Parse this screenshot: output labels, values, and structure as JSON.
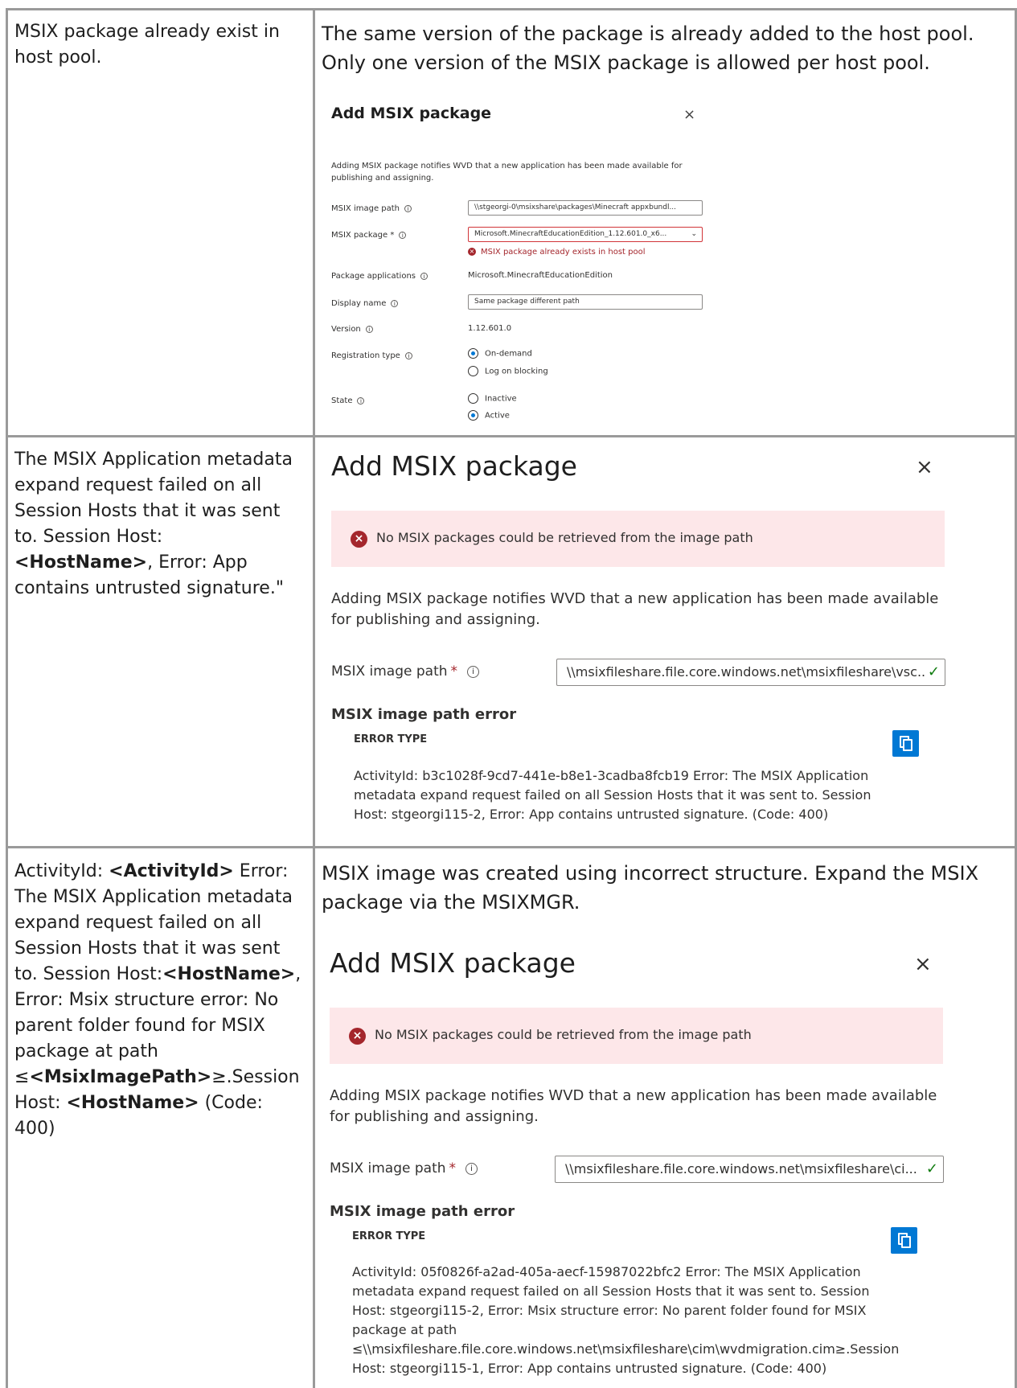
{
  "rows": [
    {
      "left_parts": [
        {
          "text": "MSIX package already exist in host pool.",
          "bold": false
        }
      ],
      "right_intro": "The same version of the package is already added to the host pool. Only one version of the MSIX package is allowed per host pool.",
      "dialog": {
        "title": "Add MSIX package",
        "close": "×",
        "description": "Adding MSIX package notifies WVD that a new application has been made available for publishing and assigning.",
        "image_path_label": "MSIX image path",
        "image_path_value": "\\\\stgeorgi-0\\msixshare\\packages\\Minecraft appxbundl...",
        "package_label": "MSIX package *",
        "package_value": "Microsoft.MinecraftEducationEdition_1.12.601.0_x6...",
        "package_error": "MSIX package already exists in host pool",
        "applications_label": "Package applications",
        "applications_value": "Microsoft.MinecraftEducationEdition",
        "display_name_label": "Display name",
        "display_name_value": "Same package different path",
        "version_label": "Version",
        "version_value": "1.12.601.0",
        "registration_label": "Registration type",
        "registration_options": [
          "On-demand",
          "Log on blocking"
        ],
        "registration_selected": "On-demand",
        "state_label": "State",
        "state_options": [
          "Inactive",
          "Active"
        ],
        "state_selected": "Active"
      }
    },
    {
      "left_parts": [
        {
          "text": "The MSIX Application metadata expand request failed on all Session Hosts that it was sent to. Session Host: ",
          "bold": false
        },
        {
          "text": "<HostName>",
          "bold": true
        },
        {
          "text": ", Error: App contains untrusted signature.\"",
          "bold": false
        }
      ],
      "dialog": {
        "title": "Add MSIX package",
        "close": "×",
        "banner": "No MSIX packages could be retrieved from the image path",
        "description": "Adding MSIX package notifies WVD that a new application has been made available for publishing and assigning.",
        "image_path_label": "MSIX image path",
        "required_mark": "*",
        "image_path_value": "\\\\msixfileshare.file.core.windows.net\\msixfileshare\\vsc...",
        "error_heading": "MSIX image path error",
        "error_type": "ERROR TYPE",
        "error_text": "ActivityId: b3c1028f-9cd7-441e-b8e1-3cadba8fcb19 Error: The MSIX Application metadata expand request failed on all Session Hosts that it was sent to. Session Host: stgeorgi115-2, Error: App contains untrusted signature. (Code: 400)"
      }
    },
    {
      "left_parts": [
        {
          "text": "ActivityId: ",
          "bold": false
        },
        {
          "text": "<ActivityId>",
          "bold": true
        },
        {
          "text": " Error: The MSIX Application metadata expand request failed on all Session Hosts that it was sent to. Session Host:",
          "bold": false
        },
        {
          "text": "<HostName>",
          "bold": true
        },
        {
          "text": ", Error: Msix structure error: No parent folder found for MSIX package at path ≤",
          "bold": false
        },
        {
          "text": "<MsixImagePath>",
          "bold": true
        },
        {
          "text": "≥.Session Host: ",
          "bold": false
        },
        {
          "text": "<HostName>",
          "bold": true
        },
        {
          "text": " (Code: 400)",
          "bold": false
        }
      ],
      "right_intro": "MSIX image was created using incorrect structure. Expand the MSIX package via the MSIXMGR.",
      "dialog": {
        "title": "Add MSIX package",
        "close": "×",
        "banner": "No MSIX packages could be retrieved from the image path",
        "description": "Adding MSIX package notifies WVD that a new application has been made available for publishing and assigning.",
        "image_path_label": "MSIX image path",
        "required_mark": "*",
        "image_path_value": "\\\\msixfileshare.file.core.windows.net\\msixfileshare\\ci...",
        "error_heading": "MSIX image path error",
        "error_type": "ERROR TYPE",
        "error_text": "ActivityId: 05f0826f-a2ad-405a-aecf-15987022bfc2 Error: The MSIX Application metadata expand request failed on all Session Hosts that it was sent to. Session Host: stgeorgi115-2, Error: Msix structure error: No parent folder found for MSIX package at path ≤\\\\msixfileshare.file.core.windows.net\\msixfileshare\\cim\\wvdmigration.cim≥.Session Host: stgeorgi115-1, Error: App contains untrusted signature. (Code: 400)"
      }
    }
  ]
}
